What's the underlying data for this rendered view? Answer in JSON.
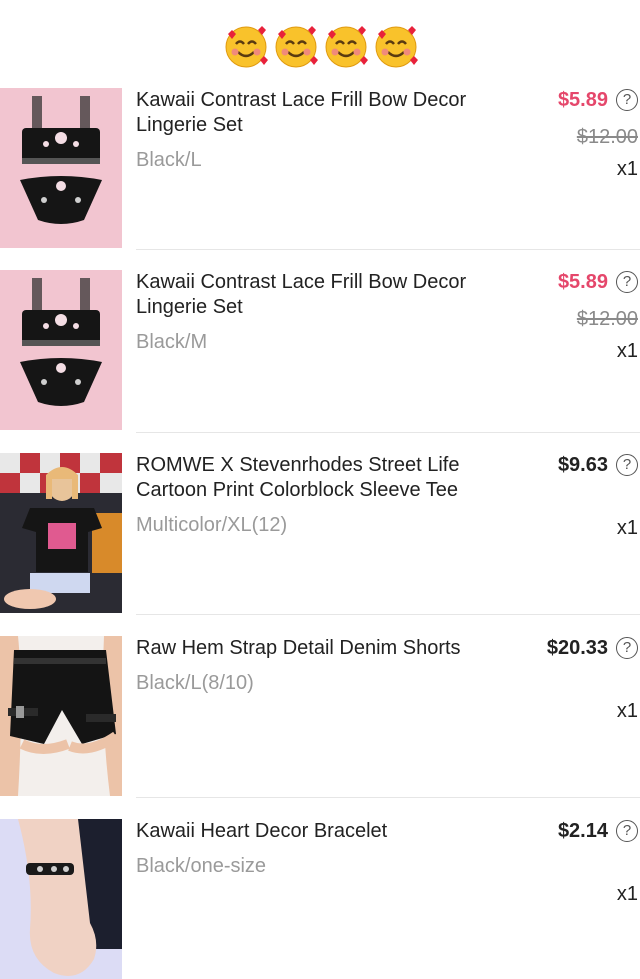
{
  "header": {
    "emoji": [
      "smiling-face-with-hearts",
      "smiling-face-with-hearts",
      "smiling-face-with-hearts",
      "smiling-face-with-hearts"
    ]
  },
  "items": [
    {
      "name": "Kawaii Contrast Lace Frill Bow Decor Lingerie Set",
      "variant": "Black/L",
      "price": "$5.89",
      "original_price": "$12.00",
      "qty": "x1",
      "help": "?",
      "image": "lingerie-image"
    },
    {
      "name": "Kawaii Contrast Lace Frill Bow Decor Lingerie Set",
      "variant": "Black/M",
      "price": "$5.89",
      "original_price": "$12.00",
      "qty": "x1",
      "help": "?",
      "image": "lingerie-image"
    },
    {
      "name": "ROMWE X Stevenrhodes Street Life Cartoon Print Colorblock Sleeve Tee",
      "variant": "Multicolor/XL(12)",
      "price": "$9.63",
      "qty": "x1",
      "help": "?",
      "image": "tee-image"
    },
    {
      "name": "Raw Hem Strap Detail Denim Shorts",
      "variant": "Black/L(8/10)",
      "price": "$20.33",
      "qty": "x1",
      "help": "?",
      "image": "shorts-image"
    },
    {
      "name": "Kawaii Heart Decor Bracelet",
      "variant": "Black/one-size",
      "price": "$2.14",
      "qty": "x1",
      "help": "?",
      "image": "bracelet-image"
    }
  ],
  "colors": {
    "sale": "#e5476b",
    "muted": "#9a9a9a",
    "divider": "#e6e6e6",
    "thumb_pink": "#f2c5d0"
  }
}
